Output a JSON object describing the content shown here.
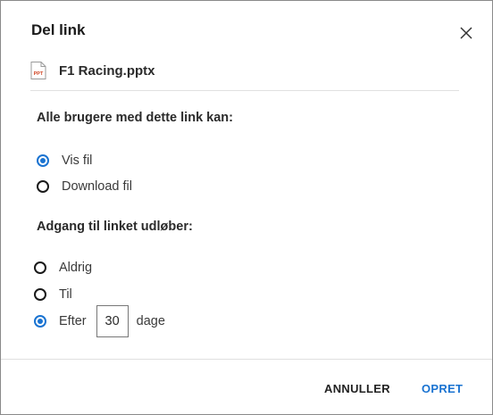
{
  "dialog": {
    "title": "Del link",
    "file": {
      "icon": "powerpoint-file-icon",
      "icon_label": "PPT",
      "name": "F1 Racing.pptx"
    },
    "permissions": {
      "heading": "Alle brugere med dette link kan:",
      "options": [
        {
          "label": "Vis fil",
          "selected": true
        },
        {
          "label": "Download fil",
          "selected": false
        }
      ]
    },
    "expiry": {
      "heading": "Adgang til linket udløber:",
      "options": [
        {
          "label": "Aldrig",
          "selected": false
        },
        {
          "label": "Til",
          "selected": false
        },
        {
          "label": "Efter",
          "selected": true
        }
      ],
      "days_value": "30",
      "days_unit": "dage"
    },
    "buttons": {
      "cancel": "ANNULLER",
      "create": "OPRET"
    },
    "colors": {
      "accent": "#1a73d1"
    }
  }
}
